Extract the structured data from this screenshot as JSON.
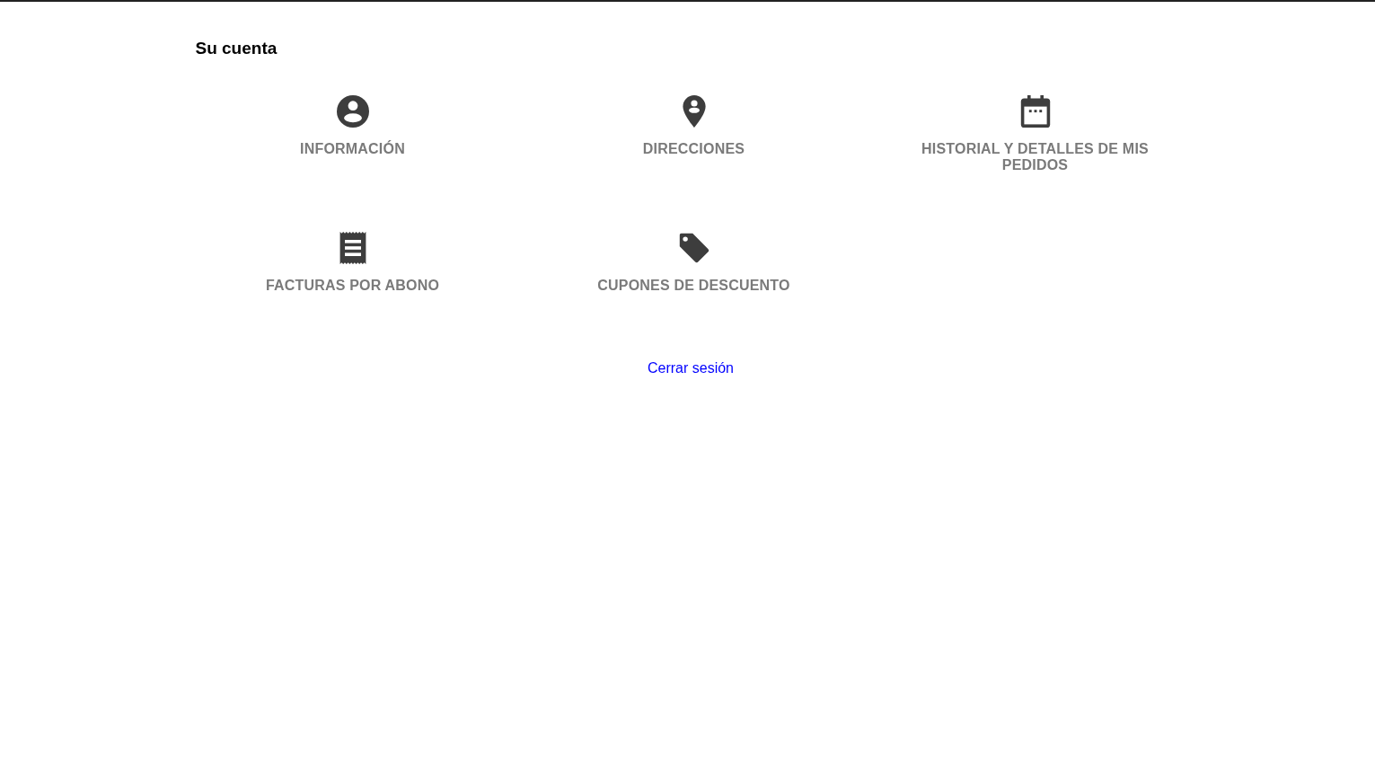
{
  "heading": "Su cuenta",
  "tiles": [
    {
      "label": "INFORMACIÓN"
    },
    {
      "label": "DIRECCIONES"
    },
    {
      "label": "HISTORIAL Y DETALLES DE MIS PEDIDOS"
    },
    {
      "label": "FACTURAS POR ABONO"
    },
    {
      "label": "CUPONES DE DESCUENTO"
    }
  ],
  "logout_link": "Cerrar sesión"
}
